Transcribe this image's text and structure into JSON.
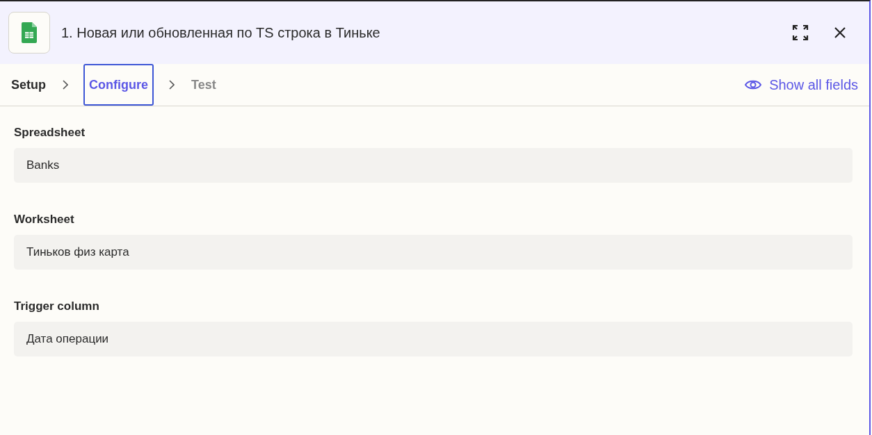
{
  "header": {
    "title": "1. Новая или обновленная по TS строка в Тиньке"
  },
  "steps": [
    {
      "label": "Setup",
      "selected": false,
      "disabled": false
    },
    {
      "label": "Configure",
      "selected": true,
      "disabled": false
    },
    {
      "label": "Test",
      "selected": false,
      "disabled": true
    }
  ],
  "show_all_fields": {
    "label": "Show all fields"
  },
  "fields": [
    {
      "label": "Spreadsheet",
      "value": "Banks"
    },
    {
      "label": "Worksheet",
      "value": "Тиньков физ карта"
    },
    {
      "label": "Trigger column",
      "value": "Дата операции"
    }
  ]
}
